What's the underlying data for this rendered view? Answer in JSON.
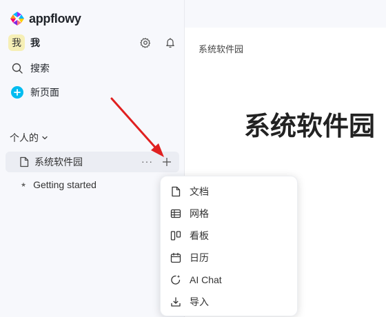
{
  "app": {
    "logo_text": "appflowy"
  },
  "user": {
    "avatar_char": "我",
    "name": "我"
  },
  "nav": {
    "search_label": "搜索",
    "new_page_label": "新页面"
  },
  "sidebar": {
    "section_label": "个人的",
    "pages": [
      {
        "label": "系统软件园"
      },
      {
        "label": "Getting started"
      }
    ],
    "more_label": "···"
  },
  "main": {
    "breadcrumb": "系统软件园",
    "title": "系统软件园"
  },
  "menu": {
    "items": [
      {
        "label": "文档",
        "icon": "document-icon"
      },
      {
        "label": "网格",
        "icon": "grid-icon"
      },
      {
        "label": "看板",
        "icon": "board-icon"
      },
      {
        "label": "日历",
        "icon": "calendar-icon"
      },
      {
        "label": "AI Chat",
        "icon": "ai-chat-icon"
      },
      {
        "label": "导入",
        "icon": "import-icon"
      }
    ]
  },
  "colors": {
    "accent": "#00bcf0",
    "arrow": "#e02020",
    "sidebar_bg": "#f7f8fc",
    "selected_bg": "#ebedf3"
  }
}
